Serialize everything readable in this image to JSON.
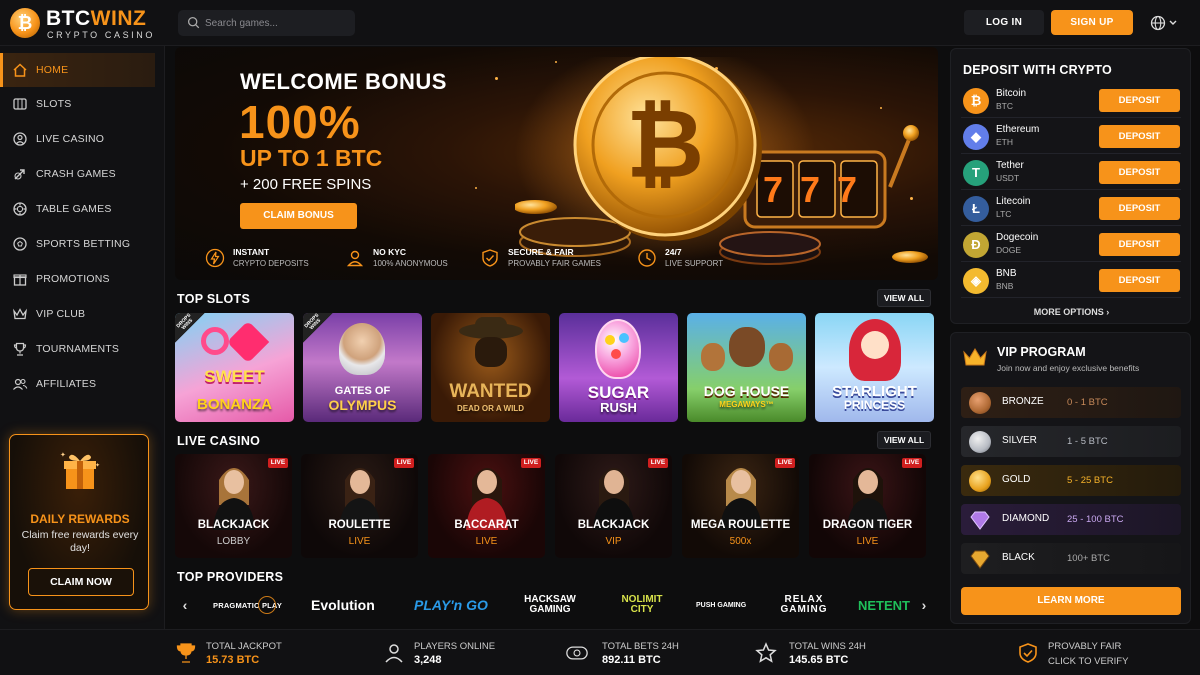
{
  "brand": {
    "name_part1": "BTC",
    "name_part2": "WINZ",
    "tagline": "CRYPTO CASINO",
    "accent": "#f7931a"
  },
  "search": {
    "placeholder": "Search games..."
  },
  "header": {
    "login": "LOG IN",
    "signup": "SIGN UP",
    "language_icon": "globe-icon"
  },
  "sidebar": {
    "items": [
      {
        "label": "HOME",
        "icon": "home-icon",
        "active": true
      },
      {
        "label": "SLOTS",
        "icon": "slot-machine-icon"
      },
      {
        "label": "LIVE CASINO",
        "icon": "dealer-icon"
      },
      {
        "label": "CRASH GAMES",
        "icon": "rocket-icon"
      },
      {
        "label": "TABLE GAMES",
        "icon": "chip-icon"
      },
      {
        "label": "SPORTS BETTING",
        "icon": "ball-icon"
      },
      {
        "label": "PROMOTIONS",
        "icon": "gift-icon"
      },
      {
        "label": "VIP CLUB",
        "icon": "crown-icon"
      },
      {
        "label": "TOURNAMENTS",
        "icon": "trophy-icon"
      },
      {
        "label": "AFFILIATES",
        "icon": "users-icon"
      }
    ]
  },
  "rewards": {
    "title": "DAILY REWARDS",
    "subtitle": "Claim free rewards every day!",
    "button": "CLAIM NOW"
  },
  "hero": {
    "line1": "WELCOME BONUS",
    "line2": "100%",
    "line3": "UP TO 1 BTC",
    "line4": "+ 200 FREE SPINS",
    "cta": "CLAIM BONUS",
    "reels": "777",
    "features": [
      {
        "title": "INSTANT",
        "sub": "CRYPTO DEPOSITS",
        "icon": "lightning-icon"
      },
      {
        "title": "NO KYC",
        "sub": "100% ANONYMOUS",
        "icon": "user-icon"
      },
      {
        "title": "SECURE & FAIR",
        "sub": "PROVABLY FAIR GAMES",
        "icon": "shield-check-icon"
      },
      {
        "title": "24/7",
        "sub": "LIVE SUPPORT",
        "icon": "clock-icon"
      }
    ]
  },
  "top_slots": {
    "title": "TOP SLOTS",
    "view_all": "VIEW ALL",
    "items": [
      {
        "name": "SWEET",
        "sub": "BONANZA",
        "drops": "DROPS WINS"
      },
      {
        "name": "GATES OF",
        "sub": "OLYMPUS",
        "drops": "DROPS WINS"
      },
      {
        "name": "WANTED",
        "sub": "DEAD OR A WILD"
      },
      {
        "name": "SUGAR",
        "sub": "RUSH"
      },
      {
        "name": "DOG HOUSE",
        "sub": "MEGAWAYS™"
      },
      {
        "name": "STARLIGHT",
        "sub": "PRINCESS"
      }
    ]
  },
  "live_casino": {
    "title": "LIVE CASINO",
    "view_all": "VIEW ALL",
    "badge": "LIVE",
    "items": [
      {
        "name": "BLACKJACK",
        "sub": "LOBBY"
      },
      {
        "name": "ROULETTE",
        "sub": "LIVE"
      },
      {
        "name": "BACCARAT",
        "sub": "LIVE"
      },
      {
        "name": "BLACKJACK",
        "sub": "VIP"
      },
      {
        "name": "MEGA ROULETTE",
        "sub": "500x"
      },
      {
        "name": "DRAGON TIGER",
        "sub": "LIVE"
      }
    ]
  },
  "providers": {
    "title": "TOP PROVIDERS",
    "items": [
      {
        "name": "PRAGMATIC PLAY"
      },
      {
        "name": "Evolution"
      },
      {
        "name": "PLAY'n GO"
      },
      {
        "name": "HACKSAW GAMING"
      },
      {
        "name": "NOLIMIT CITY"
      },
      {
        "name": "PUSH GAMING"
      },
      {
        "name": "RELAX GAMING"
      },
      {
        "name": "NETENT"
      }
    ]
  },
  "deposit": {
    "title": "DEPOSIT WITH CRYPTO",
    "button": "DEPOSIT",
    "more": "MORE OPTIONS",
    "coins": [
      {
        "name": "Bitcoin",
        "symbol": "BTC",
        "glyph": "₿",
        "color": "#f7931a"
      },
      {
        "name": "Ethereum",
        "symbol": "ETH",
        "glyph": "◆",
        "color": "#627eea"
      },
      {
        "name": "Tether",
        "symbol": "USDT",
        "glyph": "T",
        "color": "#26a17b"
      },
      {
        "name": "Litecoin",
        "symbol": "LTC",
        "glyph": "Ł",
        "color": "#345d9d"
      },
      {
        "name": "Dogecoin",
        "symbol": "DOGE",
        "glyph": "Ð",
        "color": "#c2a633"
      },
      {
        "name": "BNB",
        "symbol": "BNB",
        "glyph": "◈",
        "color": "#f3ba2f"
      }
    ]
  },
  "vip": {
    "title": "VIP PROGRAM",
    "subtitle": "Join now and enjoy exclusive benefits",
    "button": "LEARN MORE",
    "tiers": [
      {
        "name": "BRONZE",
        "range": "0 - 1 BTC",
        "color": "#b06a35"
      },
      {
        "name": "SILVER",
        "range": "1 - 5 BTC",
        "color": "#b8bcc4"
      },
      {
        "name": "GOLD",
        "range": "5 - 25 BTC",
        "color": "#e8a21e"
      },
      {
        "name": "DIAMOND",
        "range": "25 - 100 BTC",
        "color": "#a06ae8"
      },
      {
        "name": "BLACK",
        "range": "100+ BTC",
        "color": "#c9922a"
      }
    ]
  },
  "footer": {
    "stats": [
      {
        "label": "TOTAL JACKPOT",
        "value": "15.73 BTC",
        "icon": "trophy-icon",
        "accent": true
      },
      {
        "label": "PLAYERS ONLINE",
        "value": "3,248",
        "icon": "user-icon"
      },
      {
        "label": "TOTAL BETS 24H",
        "value": "892.11 BTC",
        "icon": "coins-icon"
      },
      {
        "label": "TOTAL WINS 24H",
        "value": "145.65 BTC",
        "icon": "star-icon"
      },
      {
        "label": "PROVABLY FAIR",
        "value": "CLICK TO VERIFY",
        "icon": "shield-check-icon"
      }
    ]
  }
}
